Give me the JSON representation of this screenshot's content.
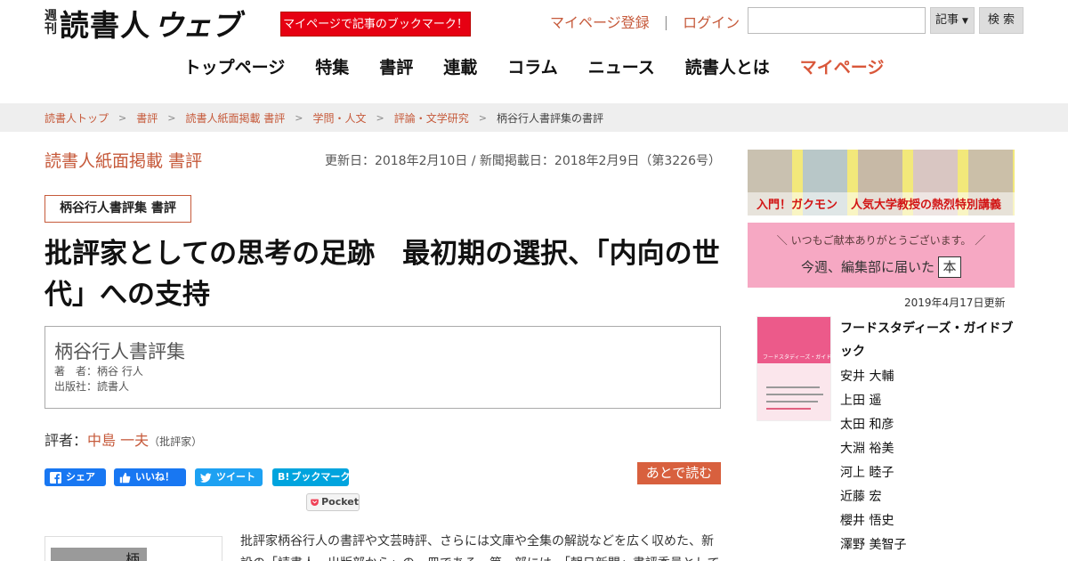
{
  "header": {
    "logo": {
      "weekly_top": "週",
      "weekly_bottom": "刊",
      "main": "読書人",
      "web": "ウェブ"
    },
    "bookmark_promo": "マイページで記事のブックマーク！",
    "register_link": "マイページ登録",
    "separator": "|",
    "login_link": "ログイン",
    "search": {
      "placeholder": "",
      "select_value": "記事",
      "button_label": "検 索"
    }
  },
  "nav": {
    "items": [
      {
        "label": "トップページ"
      },
      {
        "label": "特集"
      },
      {
        "label": "書評"
      },
      {
        "label": "連載"
      },
      {
        "label": "コラム"
      },
      {
        "label": "ニュース"
      },
      {
        "label": "読書人とは"
      },
      {
        "label": "マイページ",
        "active": true
      }
    ]
  },
  "breadcrumb": [
    "読書人トップ",
    "書評",
    "読書人紙面掲載 書評",
    "学問・人文",
    "評論・文学研究",
    "柄谷行人書評集の書評"
  ],
  "article": {
    "section_title": "読書人紙面掲載 書評",
    "dates": "更新日：2018年2月10日 / 新聞掲載日：2018年2月9日（第3226号）",
    "book_tag": "柄谷行人書評集 書評",
    "headline": "批評家としての思考の足跡　最初期の選択、「内向の世代」への支持",
    "book_box": {
      "title": "柄谷行人書評集",
      "author_line": "著　者：柄谷 行人",
      "publisher_line": "出版社：読書人"
    },
    "reviewer": {
      "prefix": "評者：",
      "name": "中島 一夫",
      "role": "（批評家）"
    },
    "share": {
      "facebook_share": "シェア",
      "facebook_like": "いいね！",
      "tweet": "ツイート",
      "hatena": "ブックマーク",
      "pocket": "Pocket"
    },
    "read_later": "あとで読む",
    "cover_char": "柄",
    "body_text": "批評家柄谷行人の書評や文芸時評、さらには文庫や全集の解説などを広く収めた、新設の「読書人　出版部から」の一冊である。第一部には、「朝日新聞」書評委員として"
  },
  "sidebar": {
    "banner_gakumon": {
      "left_text": "入門！ガクモン",
      "right_text": "人気大学教授の熱烈特別講義"
    },
    "banner_kenpon": {
      "line1": "＼ いつもご献本ありがとうございます。 ／",
      "line2": "今週、編集部に届いた",
      "hon": "本"
    },
    "updated": "2019年4月17日更新",
    "book": {
      "cover_title": "フードスタディーズ・ガイドブック",
      "title": "フードスタディーズ・ガイドブック",
      "authors": [
        "安井 大輔",
        "上田 遥",
        "太田 和彦",
        "大淵 裕美",
        "河上 睦子",
        "近藤 宏",
        "櫻井 悟史",
        "澤野 美智子"
      ]
    }
  },
  "colors": {
    "accent": "#c65a3b",
    "promo_red": "#e60012",
    "facebook": "#1877f2",
    "twitter": "#1da1f2",
    "hatena": "#00a4de",
    "read_later": "#d8603e"
  }
}
